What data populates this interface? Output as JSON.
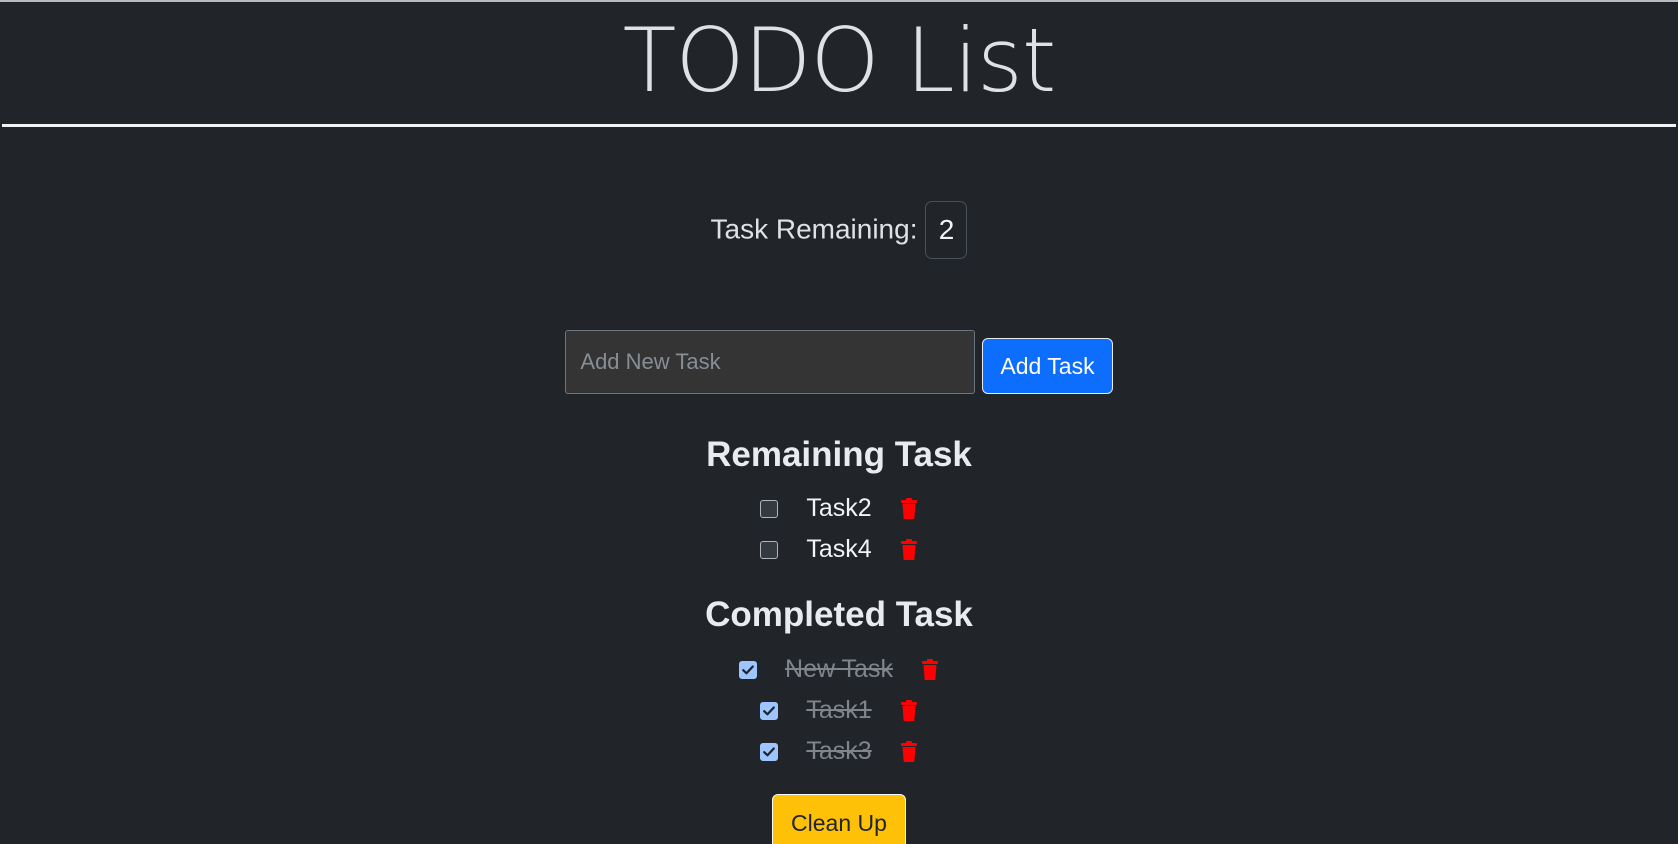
{
  "header": {
    "title": "TODO List"
  },
  "counter": {
    "label": "Task Remaining:",
    "value": "2"
  },
  "add_form": {
    "placeholder": "Add New Task",
    "button_label": "Add Task"
  },
  "remaining": {
    "heading": "Remaining Task",
    "tasks": [
      {
        "label": "Task2",
        "checked": false
      },
      {
        "label": "Task4",
        "checked": false
      }
    ]
  },
  "completed": {
    "heading": "Completed Task",
    "tasks": [
      {
        "label": "New Task",
        "checked": true
      },
      {
        "label": "Task1",
        "checked": true
      },
      {
        "label": "Task3",
        "checked": true
      }
    ]
  },
  "cleanup": {
    "button_label": "Clean Up"
  },
  "colors": {
    "background": "#212529",
    "primary_button": "#0d6efd",
    "warning_button": "#ffc107",
    "delete_icon": "#ff0000",
    "checkbox_checked": "#9ec5fe"
  },
  "icons": {
    "delete": "trash-icon",
    "check": "checkmark-icon"
  }
}
